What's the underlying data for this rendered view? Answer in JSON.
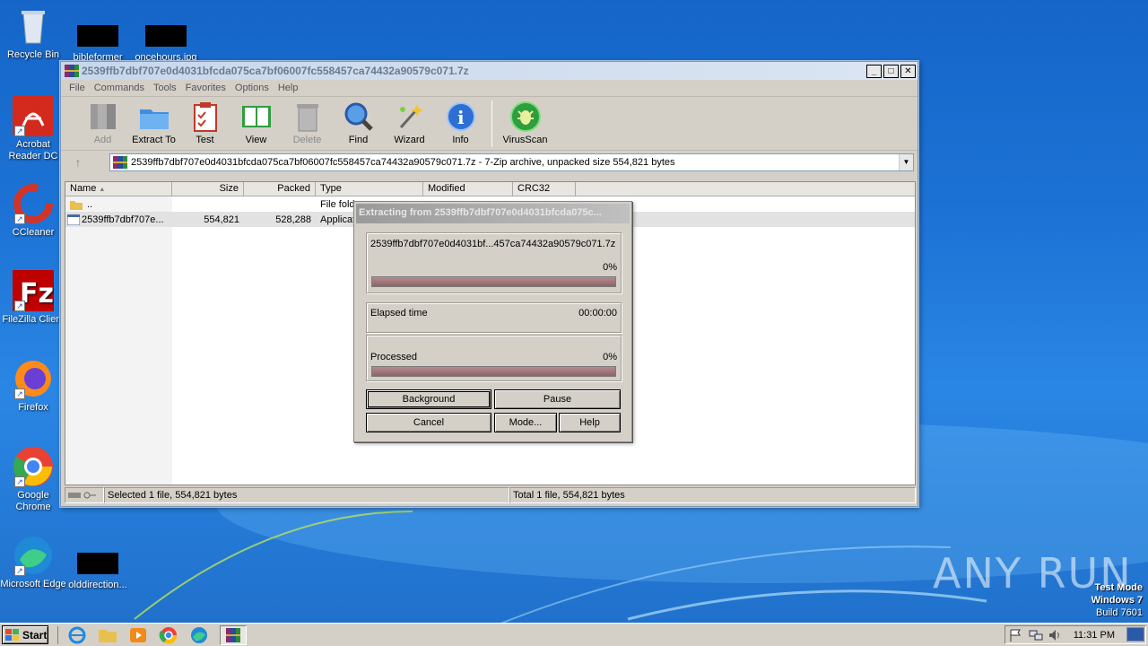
{
  "desktop": {
    "icons": [
      {
        "label": "Recycle Bin",
        "icon": "recycle-bin-icon"
      },
      {
        "label": "bibleformer",
        "icon": "redacted-file-icon"
      },
      {
        "label": "oncehours.jpg",
        "icon": "redacted-file-icon"
      },
      {
        "label": "Acrobat Reader DC",
        "icon": "acrobat-icon"
      },
      {
        "label": "CCleaner",
        "icon": "ccleaner-icon"
      },
      {
        "label": "FileZilla Client",
        "icon": "filezilla-icon"
      },
      {
        "label": "Firefox",
        "icon": "firefox-icon"
      },
      {
        "label": "Google Chrome",
        "icon": "chrome-icon"
      },
      {
        "label": "Microsoft Edge",
        "icon": "edge-icon"
      },
      {
        "label": "olddirection...",
        "icon": "redacted-file-icon"
      }
    ]
  },
  "window": {
    "title": "2539ffb7dbf707e0d4031bfcda075ca7bf06007fc558457ca74432a90579c071.7z",
    "controls": {
      "minimize": "_",
      "maximize": "□",
      "close": "✕"
    },
    "menu": [
      "File",
      "Commands",
      "Tools",
      "Favorites",
      "Options",
      "Help"
    ],
    "toolbar": [
      {
        "label": "Add",
        "icon": "add-archive-icon",
        "disabled": true
      },
      {
        "label": "Extract To",
        "icon": "extract-folder-icon",
        "disabled": false
      },
      {
        "label": "Test",
        "icon": "test-clipboard-icon",
        "disabled": false
      },
      {
        "label": "View",
        "icon": "view-book-icon",
        "disabled": false
      },
      {
        "label": "Delete",
        "icon": "delete-trash-icon",
        "disabled": true
      },
      {
        "label": "Find",
        "icon": "find-magnifier-icon",
        "disabled": false
      },
      {
        "label": "Wizard",
        "icon": "wizard-wand-icon",
        "disabled": false
      },
      {
        "label": "Info",
        "icon": "info-icon",
        "disabled": false
      },
      {
        "label": "VirusScan",
        "icon": "virusscan-icon",
        "disabled": false
      }
    ],
    "address": "2539ffb7dbf707e0d4031bfcda075ca7bf06007fc558457ca74432a90579c071.7z - 7-Zip archive, unpacked size 554,821 bytes",
    "columns": [
      "Name",
      "Size",
      "Packed",
      "Type",
      "Modified",
      "CRC32"
    ],
    "sort_indicator": "▲",
    "rows": [
      {
        "name": "..",
        "size": "",
        "packed": "",
        "type": "File fold"
      },
      {
        "name": "2539ffb7dbf707e...",
        "size": "554,821",
        "packed": "528,288",
        "type": "Applicat"
      }
    ],
    "status": {
      "left": "Selected 1 file, 554,821 bytes",
      "right": "Total 1 file, 554,821 bytes"
    }
  },
  "dialog": {
    "title": "Extracting from 2539ffb7dbf707e0d4031bfcda075c...",
    "file": "2539ffb7dbf707e0d4031bf...457ca74432a90579c071.7z",
    "file_percent": "0%",
    "elapsed_label": "Elapsed time",
    "elapsed_value": "00:00:00",
    "processed_label": "Processed",
    "processed_percent": "0%",
    "file_progress": 1.0,
    "total_progress": 1.0,
    "buttons": {
      "background": "Background",
      "pause": "Pause",
      "cancel": "Cancel",
      "mode": "Mode...",
      "help": "Help"
    }
  },
  "taskbar": {
    "start": "Start",
    "clock": "11:31 PM"
  },
  "watermark": {
    "line1": "Test Mode",
    "line2": "Windows 7",
    "line3": "Build 7601",
    "brand": "ANY RUN"
  }
}
